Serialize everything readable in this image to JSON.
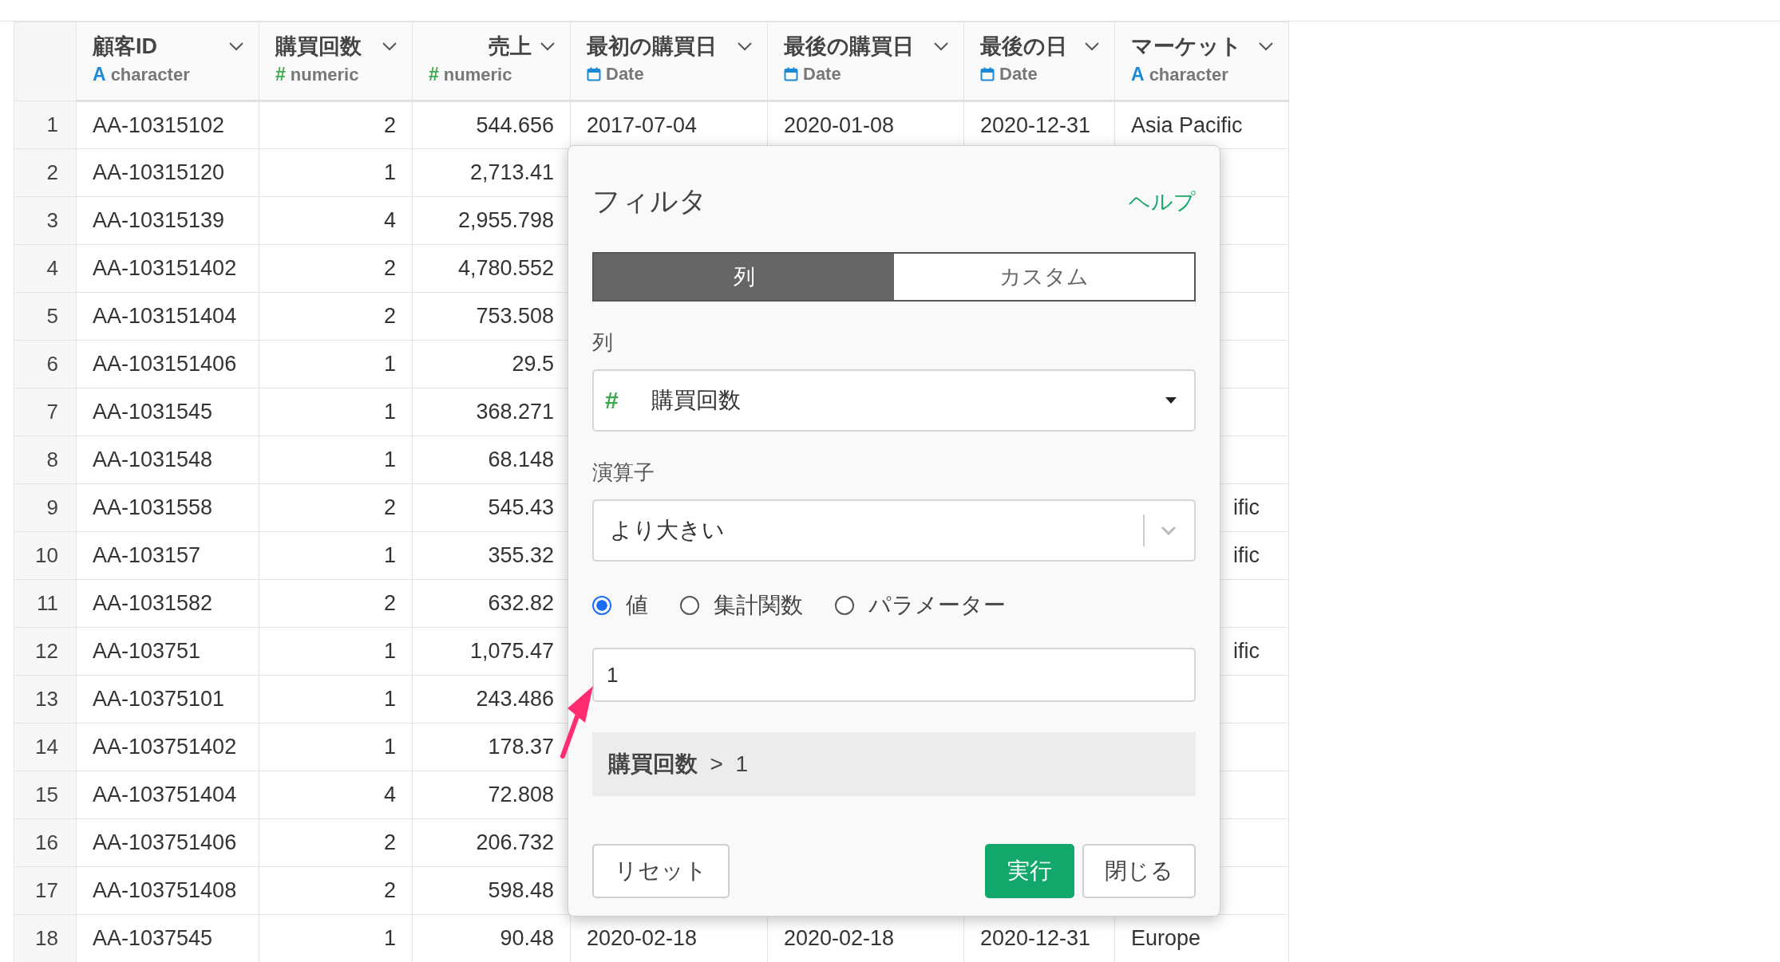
{
  "table": {
    "columns": [
      {
        "name": "顧客ID",
        "kind": "character",
        "marker": "A",
        "type": "character"
      },
      {
        "name": "購買回数",
        "kind": "numeric",
        "marker": "#",
        "type": "numeric"
      },
      {
        "name": "売上",
        "kind": "numeric",
        "marker": "#",
        "type": "numeric"
      },
      {
        "name": "最初の購買日",
        "kind": "date",
        "type": "Date"
      },
      {
        "name": "最後の購買日",
        "kind": "date",
        "type": "Date"
      },
      {
        "name": "最後の日",
        "kind": "date",
        "type": "Date"
      },
      {
        "name": "マーケット",
        "kind": "character",
        "marker": "A",
        "type": "character"
      }
    ],
    "rows": [
      {
        "num": "1",
        "cells": [
          "AA-10315102",
          "2",
          "544.656",
          "2017-07-04",
          "2020-01-08",
          "2020-12-31",
          "Asia Pacific"
        ]
      },
      {
        "num": "2",
        "cells": [
          "AA-10315120",
          "1",
          "2,713.41"
        ]
      },
      {
        "num": "3",
        "cells": [
          "AA-10315139",
          "4",
          "2,955.798"
        ]
      },
      {
        "num": "4",
        "cells": [
          "AA-103151402",
          "2",
          "4,780.552"
        ]
      },
      {
        "num": "5",
        "cells": [
          "AA-103151404",
          "2",
          "753.508"
        ]
      },
      {
        "num": "6",
        "cells": [
          "AA-103151406",
          "1",
          "29.5"
        ]
      },
      {
        "num": "7",
        "cells": [
          "AA-1031545",
          "1",
          "368.271"
        ]
      },
      {
        "num": "8",
        "cells": [
          "AA-1031548",
          "1",
          "68.148"
        ]
      },
      {
        "num": "9",
        "cells": [
          "AA-1031558",
          "2",
          "545.43"
        ],
        "market_partial": "ific"
      },
      {
        "num": "10",
        "cells": [
          "AA-103157",
          "1",
          "355.32"
        ],
        "market_partial": "ific"
      },
      {
        "num": "11",
        "cells": [
          "AA-1031582",
          "2",
          "632.82"
        ]
      },
      {
        "num": "12",
        "cells": [
          "AA-103751",
          "1",
          "1,075.47"
        ],
        "market_partial": "ific"
      },
      {
        "num": "13",
        "cells": [
          "AA-10375101",
          "1",
          "243.486"
        ]
      },
      {
        "num": "14",
        "cells": [
          "AA-103751402",
          "1",
          "178.37"
        ]
      },
      {
        "num": "15",
        "cells": [
          "AA-103751404",
          "4",
          "72.808"
        ]
      },
      {
        "num": "16",
        "cells": [
          "AA-103751406",
          "2",
          "206.732"
        ]
      },
      {
        "num": "17",
        "cells": [
          "AA-103751408",
          "2",
          "598.48"
        ]
      },
      {
        "num": "18",
        "cells": [
          "AA-1037545",
          "1",
          "90.48",
          "2020-02-18",
          "2020-02-18",
          "2020-12-31",
          "Europe"
        ]
      }
    ]
  },
  "filter_dialog": {
    "title": "フィルタ",
    "help_link": "ヘルプ",
    "tabs": [
      {
        "label": "列",
        "selected": true
      },
      {
        "label": "カスタム",
        "selected": false
      }
    ],
    "column_label": "列",
    "column_select": {
      "marker": "#",
      "value": "購買回数"
    },
    "operator_label": "演算子",
    "operator_select": {
      "value": "より大きい"
    },
    "value_sources": [
      {
        "label": "値",
        "selected": true
      },
      {
        "label": "集計関数",
        "selected": false
      },
      {
        "label": "パラメーター",
        "selected": false
      }
    ],
    "value_input": {
      "value": "1"
    },
    "expression": "**購買回数**  >  1",
    "left_buttons": [
      {
        "label": "リセット",
        "kind": "secondary"
      }
    ],
    "right_buttons": [
      {
        "label": "実行",
        "kind": "primary"
      },
      {
        "label": "閉じる",
        "kind": "secondary"
      }
    ]
  }
}
